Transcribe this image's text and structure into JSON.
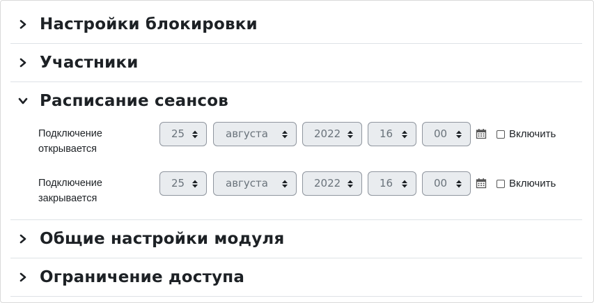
{
  "sections": {
    "lock": {
      "title": "Настройки блокировки",
      "expanded": false,
      "icon": "chevron-right-icon"
    },
    "participants": {
      "title": "Участники",
      "expanded": false,
      "icon": "chevron-right-icon"
    },
    "schedule": {
      "title": "Расписание сеансов",
      "expanded": true,
      "icon": "chevron-down-icon",
      "rows": [
        {
          "label_line1": "Подключение",
          "label_line2": "открывается",
          "day": "25",
          "month": "августа",
          "year": "2022",
          "hour": "16",
          "minute": "00",
          "enable_label": "Включить",
          "enable_checked": false
        },
        {
          "label_line1": "Подключение",
          "label_line2": "закрывается",
          "day": "25",
          "month": "августа",
          "year": "2022",
          "hour": "16",
          "minute": "00",
          "enable_label": "Включить",
          "enable_checked": false
        }
      ]
    },
    "module": {
      "title": "Общие настройки модуля",
      "expanded": false,
      "icon": "chevron-right-icon"
    },
    "access": {
      "title": "Ограничение доступа",
      "expanded": false,
      "icon": "chevron-right-icon"
    }
  },
  "colors": {
    "select_bg": "#e9ecef",
    "select_border": "#8f959e",
    "select_text": "#6a737b",
    "divider": "#dee2e6",
    "text": "#1d2125"
  }
}
